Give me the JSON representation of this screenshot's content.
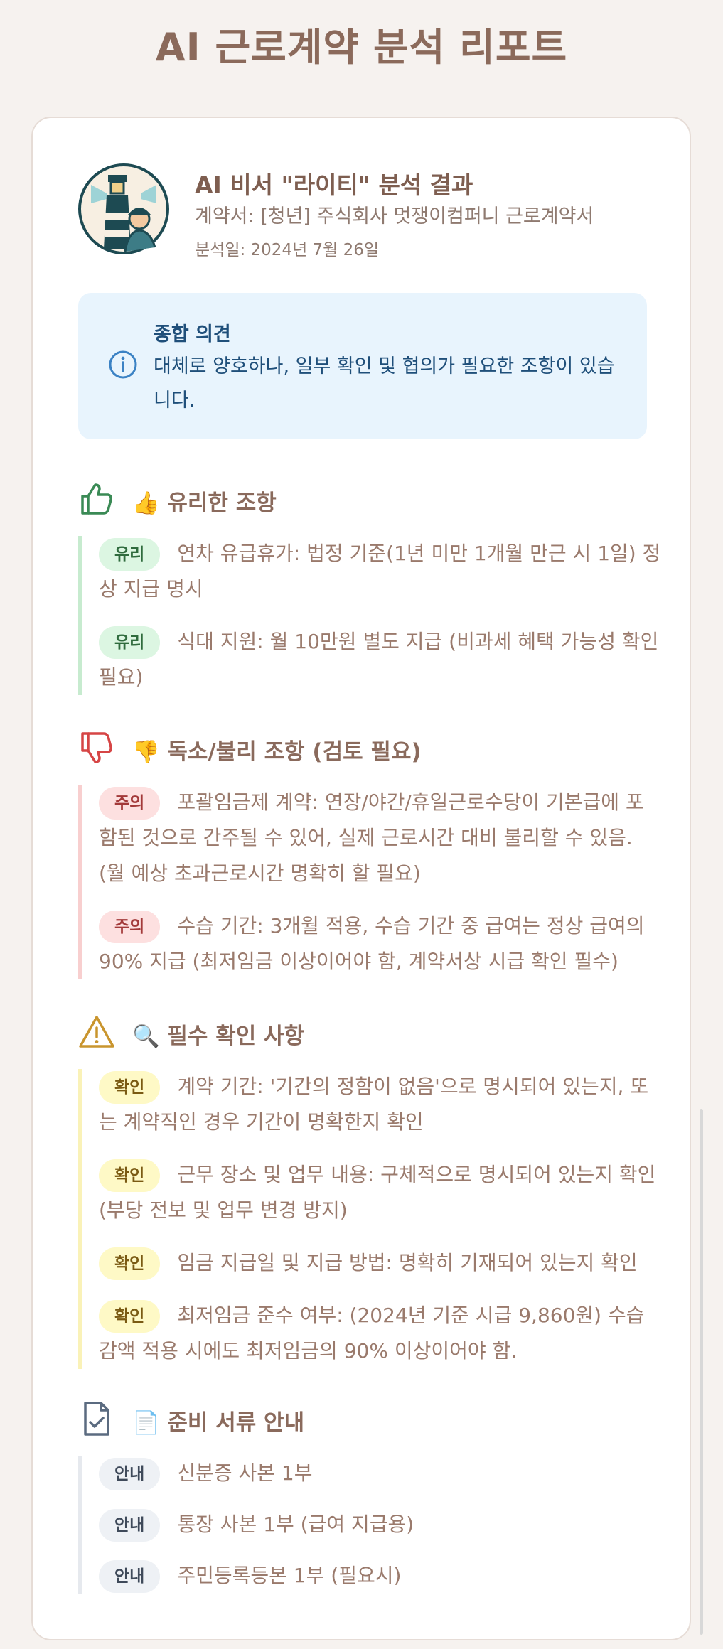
{
  "page": {
    "title": "AI 근로계약 분석 리포트"
  },
  "header": {
    "title": "AI 비서 \"라이티\" 분석 결과",
    "contract": "계약서: [청년] 주식회사 멋쟁이컴퍼니 근로계약서",
    "date": "분석일: 2024년 7월 26일"
  },
  "summary": {
    "title": "종합 의견",
    "text": "대체로 양호하나, 일부 확인 및 협의가 필요한 조항이 있습니다."
  },
  "sections": {
    "favorable": {
      "title": "👍 유리한 조항",
      "icon": "thumbs-up-icon",
      "badge": "유리",
      "items": [
        "연차 유급휴가: 법정 기준(1년 미만 1개월 만근 시 1일) 정상 지급 명시",
        "식대 지원: 월 10만원 별도 지급 (비과세 혜택 가능성 확인 필요)"
      ]
    },
    "unfavorable": {
      "title": "👎 독소/불리 조항 (검토 필요)",
      "icon": "thumbs-down-icon",
      "badge": "주의",
      "items": [
        "포괄임금제 계약: 연장/야간/휴일근로수당이 기본급에 포함된 것으로 간주될 수 있어, 실제 근로시간 대비 불리할 수 있음. (월 예상 초과근로시간 명확히 할 필요)",
        "수습 기간: 3개월 적용, 수습 기간 중 급여는 정상 급여의 90% 지급 (최저임금 이상이어야 함, 계약서상 시급 확인 필수)"
      ]
    },
    "checklist": {
      "title": "🔍 필수 확인 사항",
      "icon": "warning-triangle-icon",
      "badge": "확인",
      "items": [
        "계약 기간: '기간의 정함이 없음'으로 명시되어 있는지, 또는 계약직인 경우 기간이 명확한지 확인",
        "근무 장소 및 업무 내용: 구체적으로 명시되어 있는지 확인 (부당 전보 및 업무 변경 방지)",
        "임금 지급일 및 지급 방법: 명확히 기재되어 있는지 확인",
        "최저임금 준수 여부: (2024년 기준 시급 9,860원) 수습 감액 적용 시에도 최저임금의 90% 이상이어야 함."
      ]
    },
    "documents": {
      "title": "📄 준비 서류 안내",
      "icon": "document-check-icon",
      "badge": "안내",
      "items": [
        "신분증 사본 1부",
        "통장 사본 1부 (급여 지급용)",
        "주민등록등본 1부 (필요시)"
      ]
    }
  },
  "colors": {
    "background": "#f6f2ef",
    "title": "#8b6a5b",
    "summary_bg": "#e8f4fd",
    "good": "#3a8a55",
    "bad": "#d64545",
    "warn": "#c9952e",
    "docs": "#5b6b80"
  }
}
